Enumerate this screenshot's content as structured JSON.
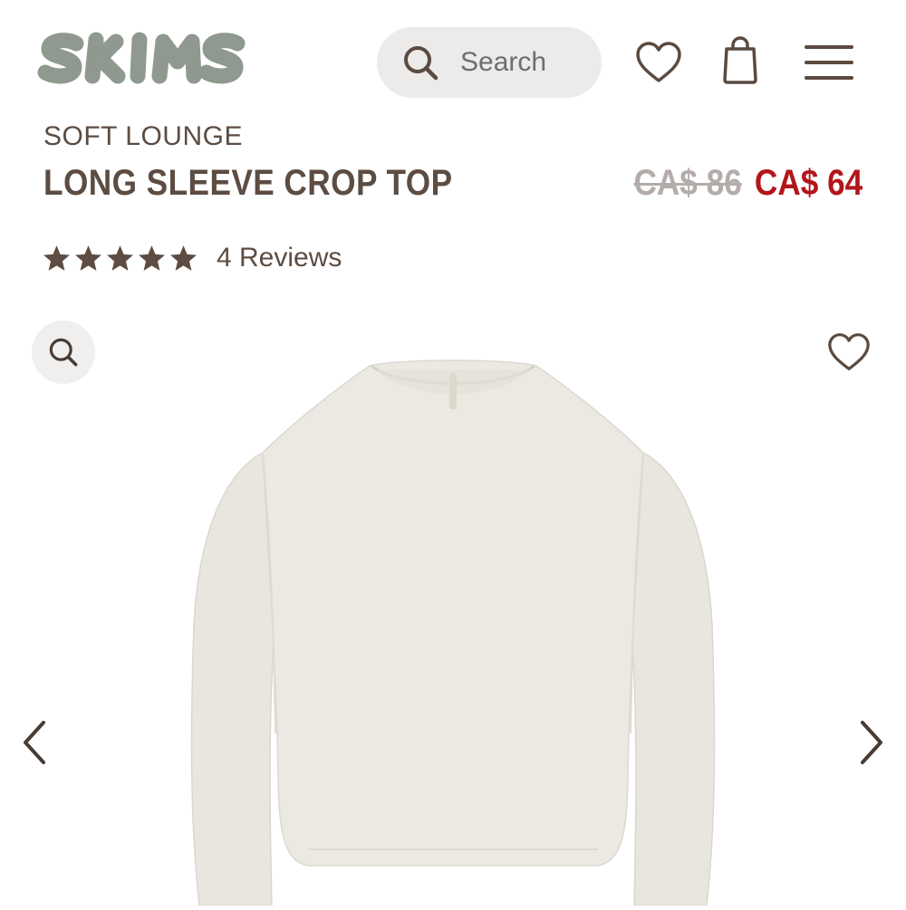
{
  "header": {
    "logo_text": "SKIMS",
    "search_placeholder": "Search"
  },
  "product": {
    "collection": "SOFT LOUNGE",
    "title": "LONG SLEEVE CROP TOP",
    "original_price": "CA$ 86",
    "sale_price": "CA$ 64",
    "rating": 5,
    "reviews_label": "4 Reviews"
  },
  "icons": {
    "search": "search-icon",
    "wishlist": "heart-icon",
    "bag": "shopping-bag-icon",
    "menu": "hamburger-menu-icon",
    "zoom": "zoom-icon",
    "prev": "chevron-left-icon",
    "next": "chevron-right-icon"
  },
  "colors": {
    "logo": "#8f998f",
    "text": "#5c4c42",
    "sale": "#b3151b",
    "strike": "#b3acaa",
    "search_bg": "#ecebea"
  }
}
